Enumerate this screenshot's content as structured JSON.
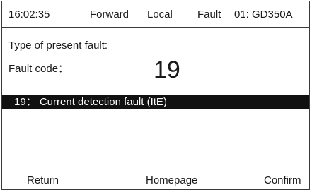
{
  "status_bar": {
    "time": "16:02:35",
    "direction": "Forward",
    "control_mode": "Local",
    "state": "Fault",
    "model": "01: GD350A"
  },
  "main": {
    "type_label": "Type of present fault:",
    "code_label": "Fault code：",
    "code_value": "19",
    "fault_description": "19： Current detection fault (ItE)"
  },
  "softkeys": {
    "return_label": "Return",
    "homepage_label": "Homepage",
    "confirm_label": "Confirm"
  },
  "colors": {
    "highlight_bg": "#111111",
    "highlight_text": "#ffffff",
    "border": "#3a3a3a"
  }
}
